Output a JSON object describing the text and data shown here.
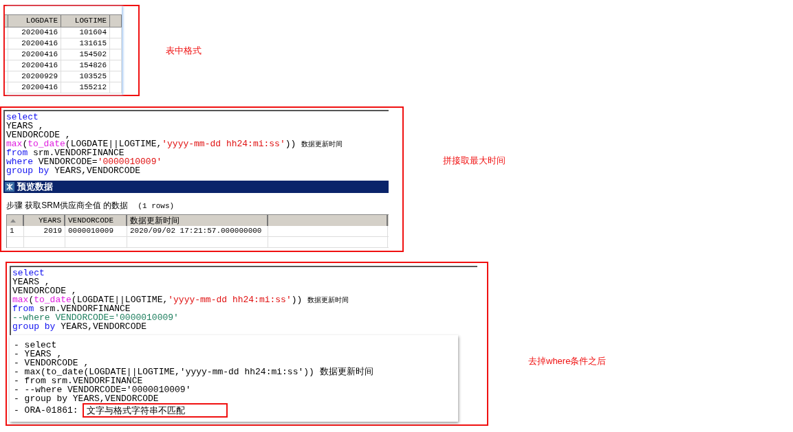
{
  "source_table": {
    "columns": [
      "LOGDATE",
      "LOGTIME"
    ],
    "rows": [
      [
        "20200416",
        "101604"
      ],
      [
        "20200416",
        "131615"
      ],
      [
        "20200416",
        "154502"
      ],
      [
        "20200416",
        "154826"
      ],
      [
        "20200929",
        "103525"
      ],
      [
        "20200416",
        "155212"
      ]
    ],
    "note": "表中格式"
  },
  "query_result": {
    "code_lines": [
      [
        {
          "kind": "kw",
          "text": "select"
        }
      ],
      [
        {
          "kind": "plain",
          "text": "YEARS ,"
        }
      ],
      [
        {
          "kind": "plain",
          "text": "VENDORCODE ,"
        }
      ],
      [
        {
          "kind": "fn",
          "text": "max"
        },
        {
          "kind": "plain",
          "text": "("
        },
        {
          "kind": "fn",
          "text": "to_date"
        },
        {
          "kind": "plain",
          "text": "(LOGDATE||LOGTIME,"
        },
        {
          "kind": "str",
          "text": "'yyyy-mm-dd hh24:mi:ss'"
        },
        {
          "kind": "plain",
          "text": ")) "
        },
        {
          "kind": "alias",
          "text": "数据更新时间"
        }
      ],
      [
        {
          "kind": "kw",
          "text": "from"
        },
        {
          "kind": "plain",
          "text": " srm.VENDORFINANCE"
        }
      ],
      [
        {
          "kind": "kw",
          "text": "where"
        },
        {
          "kind": "plain",
          "text": " VENDORCODE="
        },
        {
          "kind": "str",
          "text": "'0000010009'"
        }
      ],
      [
        {
          "kind": "kw",
          "text": "group by"
        },
        {
          "kind": "plain",
          "text": " YEARS,VENDORCODE"
        }
      ]
    ],
    "preview_title": "预览数据",
    "step_caption": "步骤 获取SRM供应商全值 的数据",
    "row_count": "(1 rows)",
    "grid": {
      "columns": [
        "YEARS",
        "VENDORCODE",
        "数据更新时间"
      ],
      "rows": [
        {
          "index": "1",
          "cells": [
            "2019",
            "0000010009",
            "2020/09/02 17:21:57.000000000"
          ]
        }
      ]
    },
    "note": "拼接取最大时间"
  },
  "error_case": {
    "code_lines": [
      [
        {
          "kind": "kw",
          "text": "select"
        }
      ],
      [
        {
          "kind": "plain",
          "text": "YEARS ,"
        }
      ],
      [
        {
          "kind": "plain",
          "text": "VENDORCODE ,"
        }
      ],
      [
        {
          "kind": "fn",
          "text": "max"
        },
        {
          "kind": "plain",
          "text": "("
        },
        {
          "kind": "fn",
          "text": "to_date"
        },
        {
          "kind": "plain",
          "text": "(LOGDATE||LOGTIME,"
        },
        {
          "kind": "str",
          "text": "'yyyy-mm-dd hh24:mi:ss'"
        },
        {
          "kind": "plain",
          "text": ")) "
        },
        {
          "kind": "alias",
          "text": "数据更新时间"
        }
      ],
      [
        {
          "kind": "kw",
          "text": "from"
        },
        {
          "kind": "plain",
          "text": " srm.VENDORFINANCE"
        }
      ],
      [
        {
          "kind": "cmt",
          "text": "--where VENDORCODE='0000010009'"
        }
      ],
      [
        {
          "kind": "kw",
          "text": "group by"
        },
        {
          "kind": "plain",
          "text": " YEARS,VENDORCODE"
        }
      ]
    ],
    "error_lines": [
      "- select",
      "- YEARS ,",
      "- VENDORCODE ,",
      "- max(to_date(LOGDATE||LOGTIME,'yyyy-mm-dd hh24:mi:ss')) 数据更新时间",
      "- from srm.VENDORFINANCE",
      "- --where VENDORCODE='0000010009'",
      "- group by YEARS,VENDORCODE"
    ],
    "error_code": "- ORA-01861:",
    "error_message": "文字与格式字符串不匹配",
    "note": "去掉where条件之后"
  }
}
